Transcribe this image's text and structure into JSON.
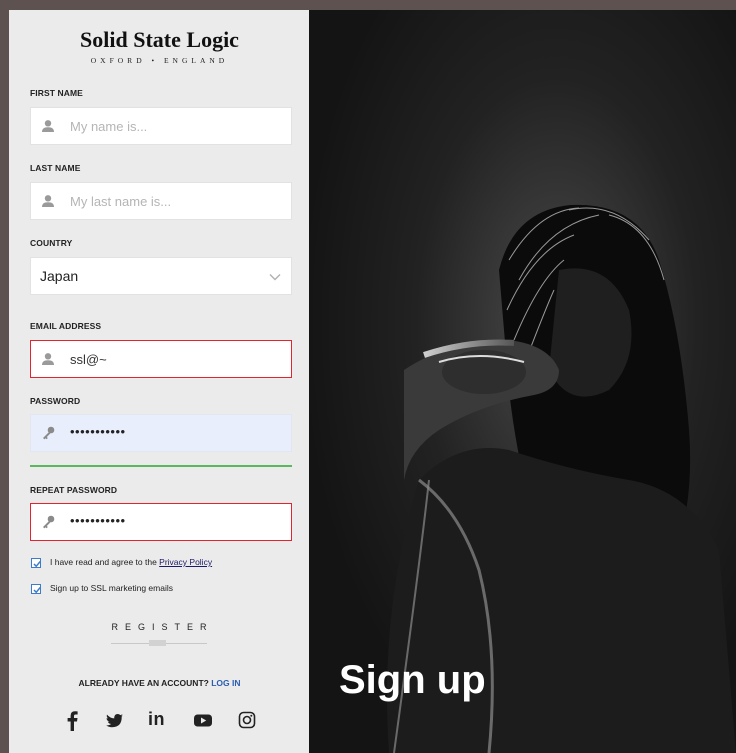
{
  "brand": {
    "name": "Solid State Logic",
    "tagline": "OXFORD • ENGLAND"
  },
  "form": {
    "first_name": {
      "label": "FIRST NAME",
      "placeholder": "My name is...",
      "icon": "user-icon"
    },
    "last_name": {
      "label": "LAST NAME",
      "placeholder": "My last name is...",
      "icon": "user-icon"
    },
    "country": {
      "label": "COUNTRY",
      "value": "Japan"
    },
    "email": {
      "label": "EMAIL ADDRESS",
      "value": "ssl@~",
      "icon": "user-icon",
      "state": "error"
    },
    "password": {
      "label": "PASSWORD",
      "value": "•••••••••••",
      "icon": "key-icon"
    },
    "repeat_password": {
      "label": "REPEAT PASSWORD",
      "value": "•••••••••••",
      "icon": "key-icon",
      "state": "error"
    },
    "password_strength_color": "#5cb85c",
    "privacy": {
      "text": "I have read and agree to the ",
      "link": "Privacy Policy",
      "checked": true
    },
    "marketing": {
      "text": "Sign up to SSL marketing emails",
      "checked": true
    },
    "register_label": "REGISTER"
  },
  "account": {
    "prompt": "ALREADY HAVE AN ACCOUNT? ",
    "login_label": "LOG IN"
  },
  "social": [
    "facebook-icon",
    "twitter-icon",
    "linkedin-icon",
    "youtube-icon",
    "instagram-icon"
  ],
  "hero": {
    "title": "Sign up"
  },
  "colors": {
    "error": "#e0252f",
    "checkbox": "#3d7cc9",
    "link": "#2a5db0"
  }
}
